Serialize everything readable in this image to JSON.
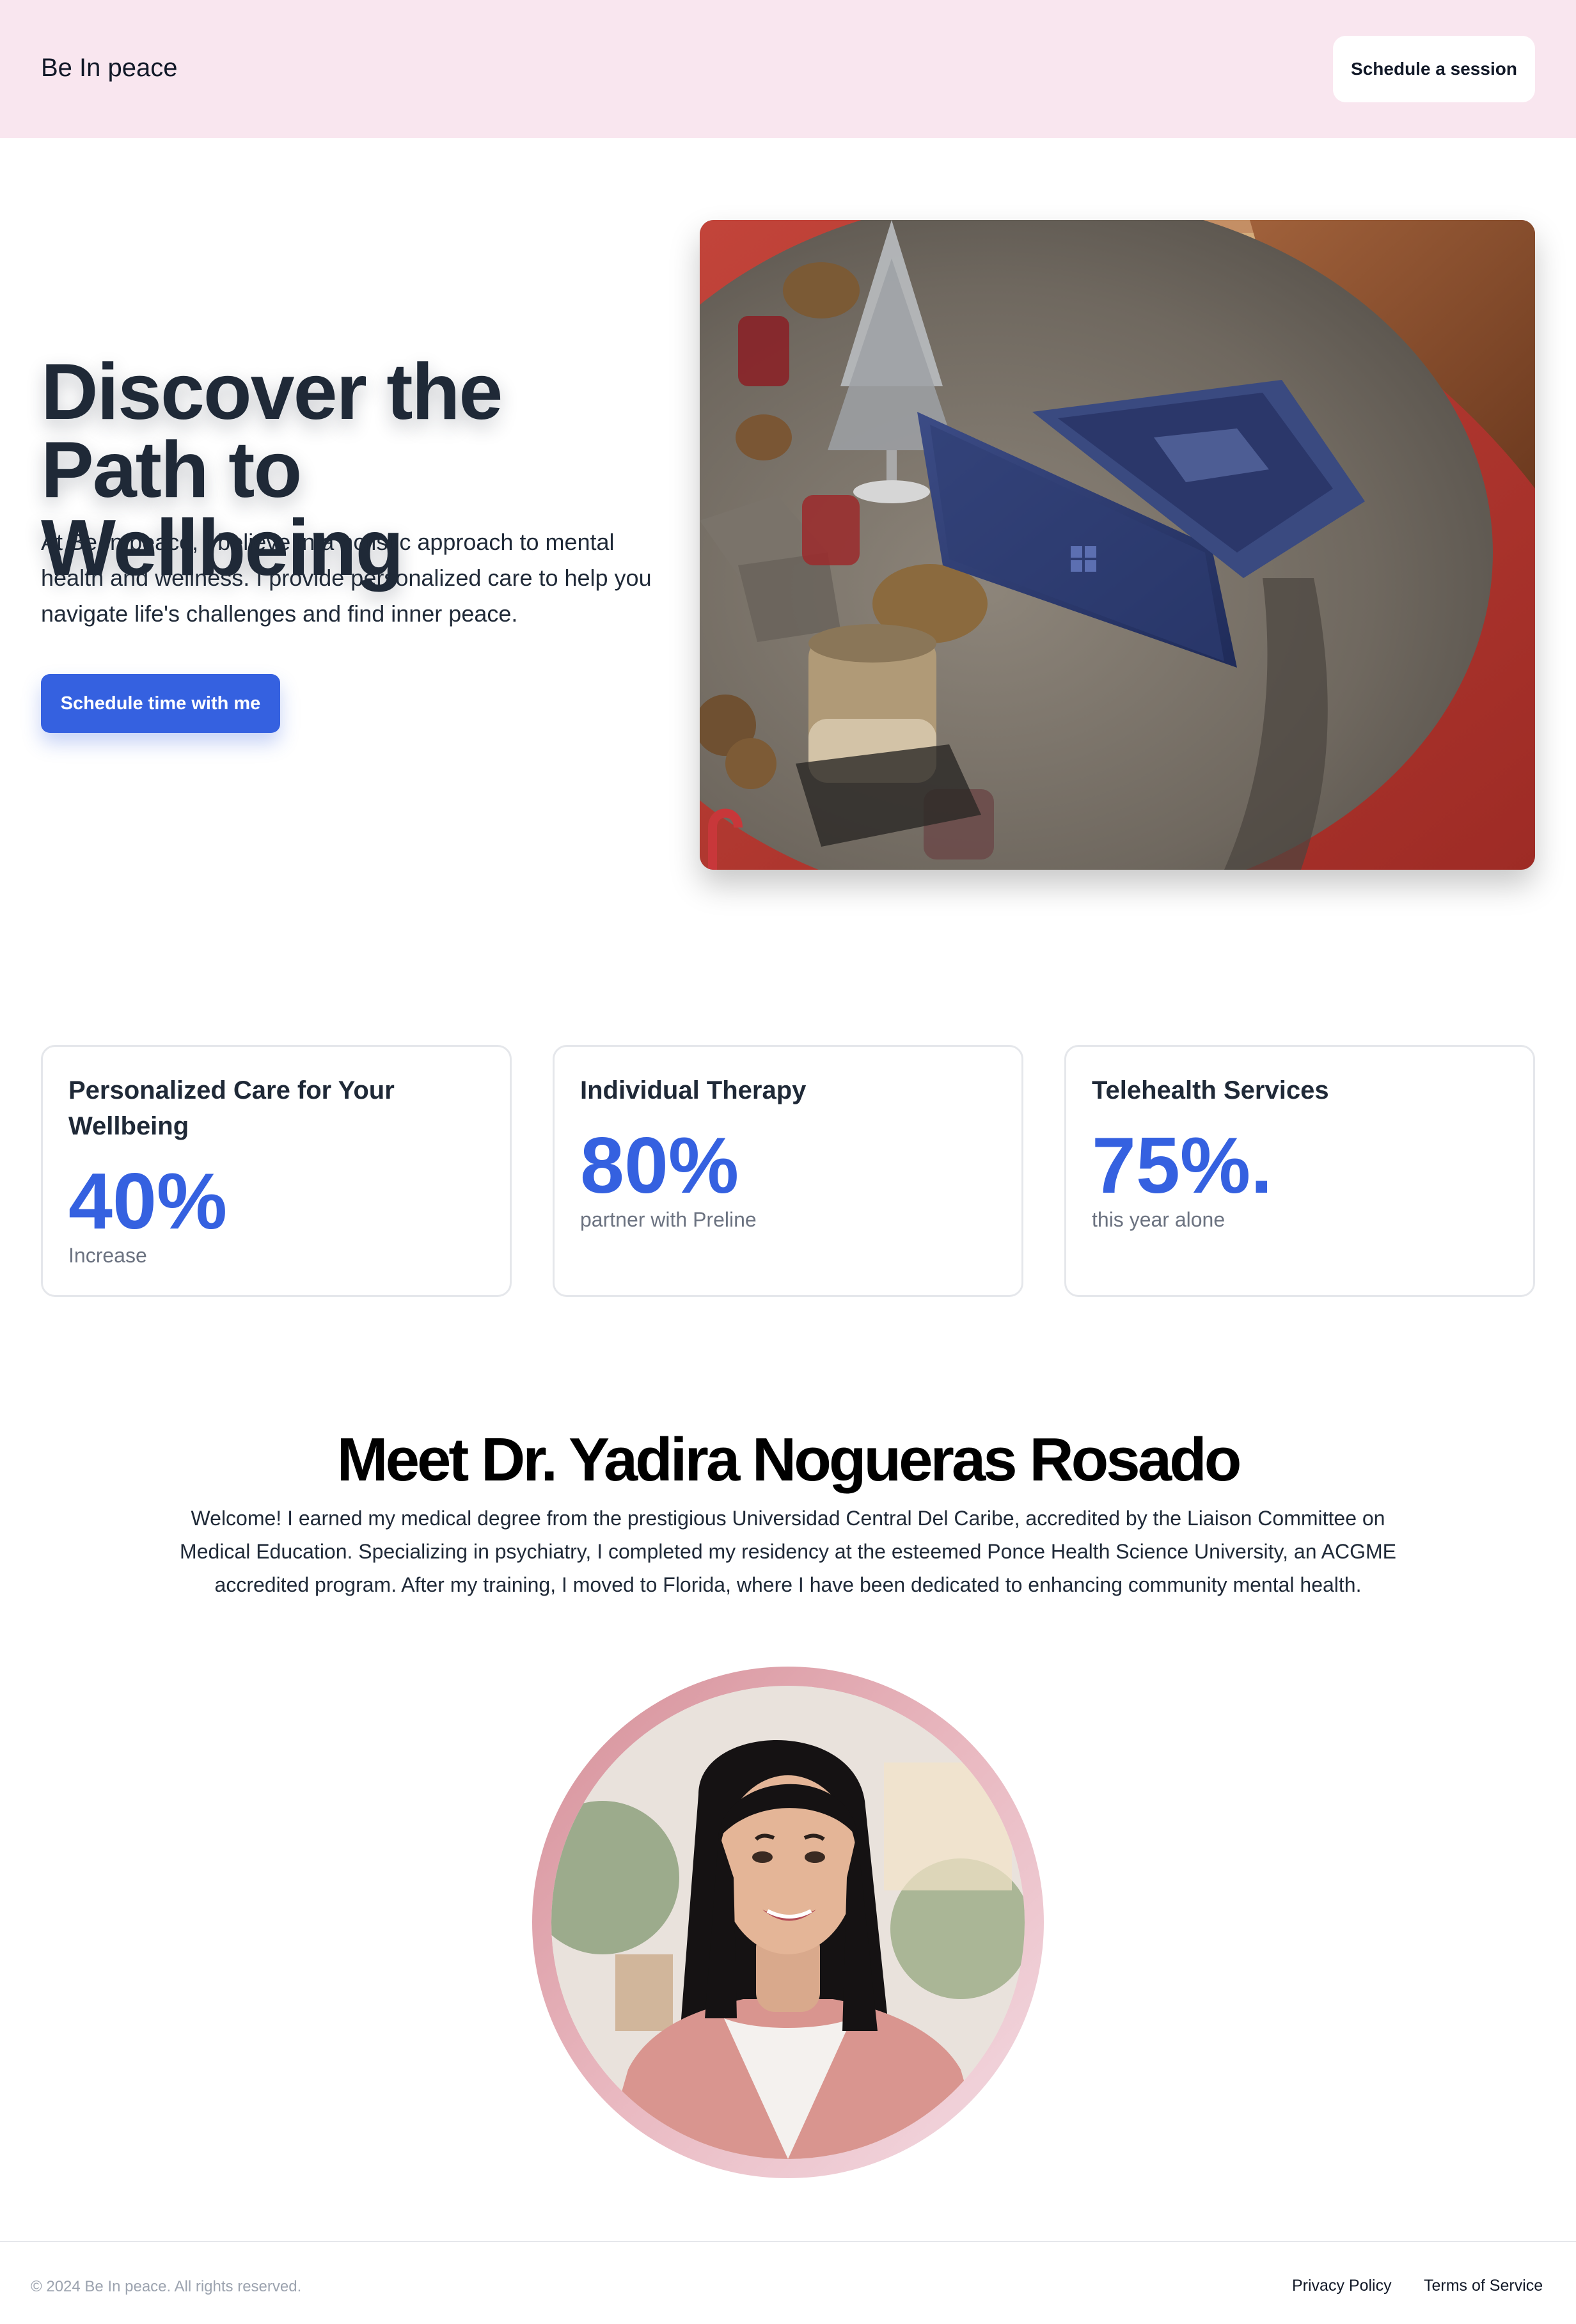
{
  "header": {
    "brand": "Be In peace",
    "cta_label": "Schedule a session"
  },
  "hero": {
    "title": "Discover the Path to Wellbeing",
    "text": "At Be In peace, I believe in a holistic approach to mental health and wellness. I provide personalized care to help you navigate life's challenges and find inner peace.",
    "cta_label": "Schedule time with me"
  },
  "stats": [
    {
      "title": "Personalized Care for Your Wellbeing",
      "value": "40%",
      "subtitle": "Increase"
    },
    {
      "title": "Individual Therapy",
      "value": "80%",
      "subtitle": "partner with Preline"
    },
    {
      "title": "Telehealth Services",
      "value": "75%.",
      "subtitle": "this year alone"
    }
  ],
  "about": {
    "title": "Meet Dr. Yadira Nogueras Rosado",
    "text": "Welcome! I earned my medical degree from the prestigious Universidad Central Del Caribe, accredited by the Liaison Committee on Medical Education. Specializing in psychiatry, I completed my residency at the esteemed Ponce Health Science University, an ACGME accredited program. After my training, I moved to Florida, where I have been dedicated to enhancing community mental health."
  },
  "footer": {
    "copyright": "© 2024 Be In peace. All rights reserved.",
    "privacy_label": "Privacy Policy",
    "terms_label": "Terms of Service"
  },
  "colors": {
    "header_bg": "#f9e6ef",
    "accent": "#3561e0",
    "heading": "#1f2937",
    "muted": "#6b7280"
  }
}
